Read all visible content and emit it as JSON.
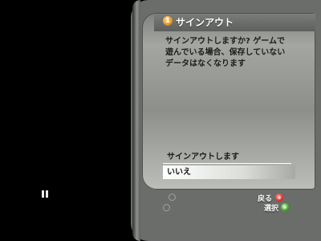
{
  "dialog": {
    "title": "サインアウト",
    "title_icon": "1",
    "message": "サインアウトしますか? ゲームで\n遊んでいる場合、保存していない\nデータはなくなります"
  },
  "options": [
    {
      "label": "サインアウトします",
      "selected": false
    },
    {
      "label": "いいえ",
      "selected": true
    }
  ],
  "controller_hints": {
    "back_label": "戻る",
    "select_label": "選択",
    "back_button_color": "#d22222",
    "select_button_color": "#3aa21e"
  },
  "status": {
    "pause_icon": "pause-icon"
  },
  "colors": {
    "background": "#000000",
    "panel": "#9c9e9a",
    "title_accent": "#e08a12",
    "highlight": "#ffffff"
  }
}
